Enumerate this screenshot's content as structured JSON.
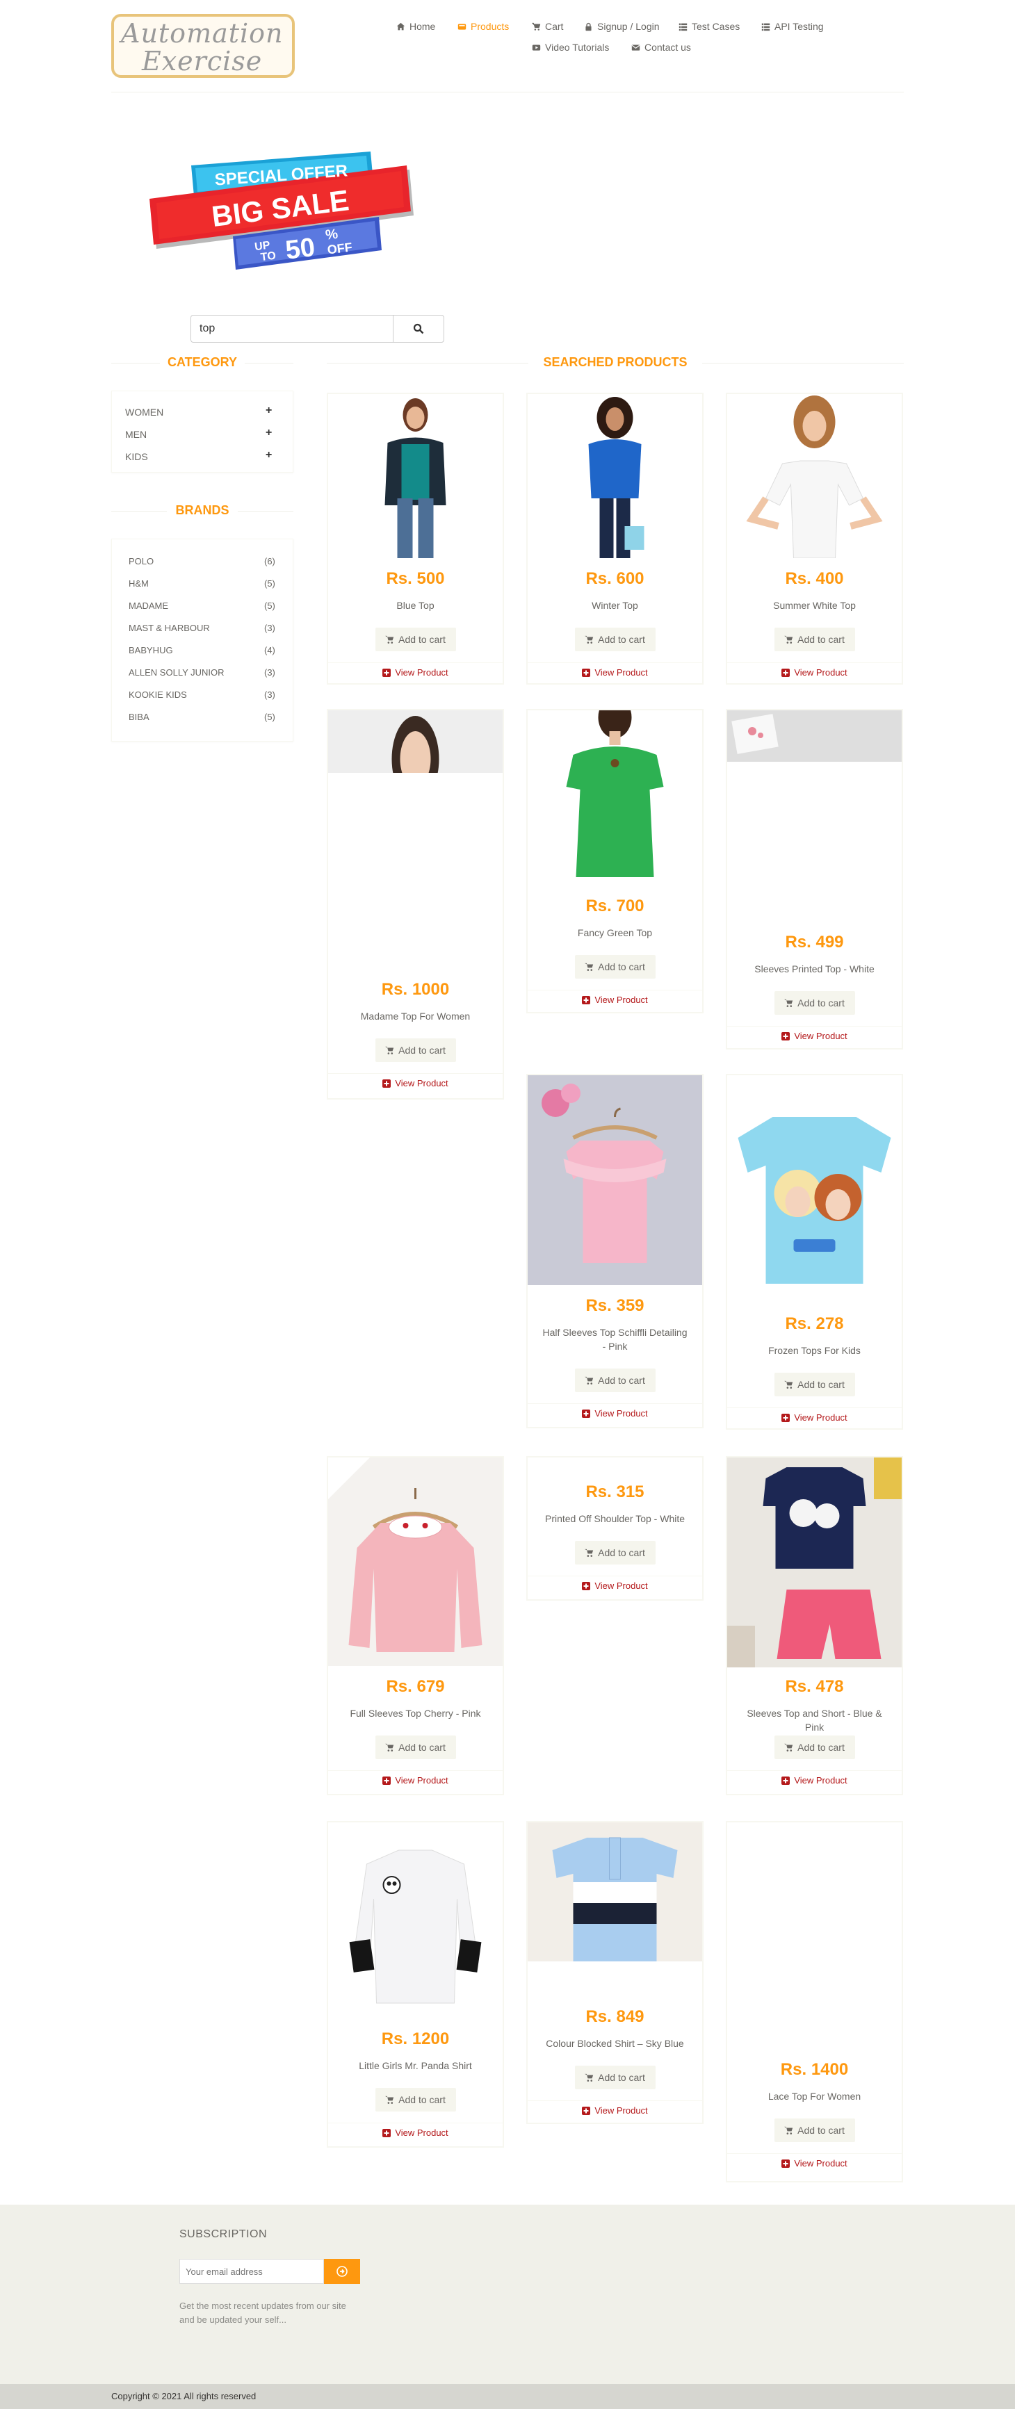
{
  "header": {
    "logo_line1": "Automation",
    "logo_line2": "Exercise",
    "nav": [
      {
        "label": "Home",
        "icon": "home-icon"
      },
      {
        "label": "Products",
        "icon": "products-icon",
        "active": true
      },
      {
        "label": "Cart",
        "icon": "cart-icon"
      },
      {
        "label": "Signup / Login",
        "icon": "lock-icon"
      },
      {
        "label": "Test Cases",
        "icon": "list-icon"
      },
      {
        "label": "API Testing",
        "icon": "list-icon"
      },
      {
        "label": "Video Tutorials",
        "icon": "youtube-icon"
      },
      {
        "label": "Contact us",
        "icon": "envelope-icon"
      }
    ]
  },
  "banner": {
    "line1": "SPECIAL OFFER",
    "line2": "BIG SALE",
    "line3_a": "UP",
    "line3_b": "TO",
    "line3_num": "50",
    "line3_pct": "%",
    "line3_off": "OFF"
  },
  "search": {
    "value": "top"
  },
  "sidebar": {
    "category_title": "Category",
    "categories": [
      "Women",
      "Men",
      "Kids"
    ],
    "brands_title": "Brands",
    "brands": [
      {
        "name": "Polo",
        "count": "(6)"
      },
      {
        "name": "H&M",
        "count": "(5)"
      },
      {
        "name": "Madame",
        "count": "(5)"
      },
      {
        "name": "Mast & Harbour",
        "count": "(3)"
      },
      {
        "name": "Babyhug",
        "count": "(4)"
      },
      {
        "name": "Allen Solly Junior",
        "count": "(3)"
      },
      {
        "name": "Kookie Kids",
        "count": "(3)"
      },
      {
        "name": "Biba",
        "count": "(5)"
      }
    ]
  },
  "products_title": "Searched Products",
  "products": [
    {
      "name": "Blue Top",
      "price": "Rs. 500"
    },
    {
      "name": "Winter Top",
      "price": "Rs. 600"
    },
    {
      "name": "Summer White Top",
      "price": "Rs. 400"
    },
    {
      "name": "Madame Top For Women",
      "price": "Rs. 1000"
    },
    {
      "name": "Fancy Green Top",
      "price": "Rs. 700"
    },
    {
      "name": "Sleeves Printed Top - White",
      "price": "Rs. 499"
    },
    {
      "name": "Half Sleeves Top Schiffli Detailing - Pink",
      "price": "Rs. 359"
    },
    {
      "name": "Frozen Tops For Kids",
      "price": "Rs. 278"
    },
    {
      "name": "Full Sleeves Top Cherry - Pink",
      "price": "Rs. 679"
    },
    {
      "name": "Printed Off Shoulder Top - White",
      "price": "Rs. 315"
    },
    {
      "name": "Sleeves Top and Short - Blue & Pink",
      "price": "Rs. 478"
    },
    {
      "name": "Little Girls Mr. Panda Shirt",
      "price": "Rs. 1200"
    },
    {
      "name": "Colour Blocked Shirt – Sky Blue",
      "price": "Rs. 849"
    },
    {
      "name": "Lace Top For Women",
      "price": "Rs. 1400"
    }
  ],
  "labels": {
    "add_to_cart": "Add to cart",
    "view_product": "View Product"
  },
  "footer": {
    "subscription_title": "Subscription",
    "email_placeholder": "Your email address",
    "subscribe_text": "Get the most recent updates from our site and be updated your self...",
    "copyright": "Copyright © 2021 All rights reserved"
  }
}
